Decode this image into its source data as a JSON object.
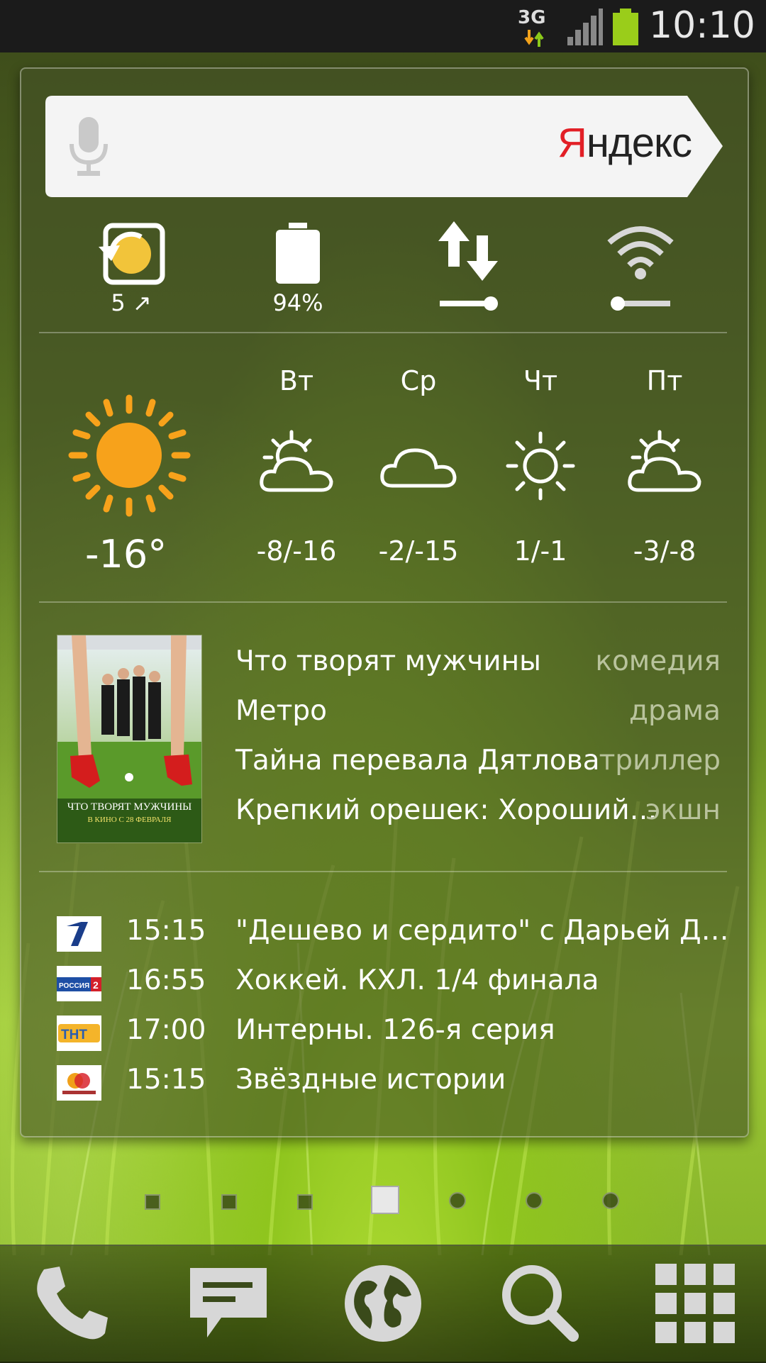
{
  "status_bar": {
    "network": "3G",
    "time": "10:10",
    "icons": [
      "data-arrows-icon",
      "signal-icon",
      "battery-icon"
    ]
  },
  "search": {
    "logo_first": "Я",
    "logo_rest": "ндекс",
    "icon": "microphone-icon"
  },
  "toggles": [
    {
      "name": "rotate",
      "icon": "screen-rotate-icon",
      "label": "5 ↗"
    },
    {
      "name": "battery",
      "icon": "battery-icon",
      "label": "94%"
    },
    {
      "name": "data",
      "icon": "data-sync-icon",
      "label": ""
    },
    {
      "name": "wifi",
      "icon": "wifi-icon",
      "label": ""
    }
  ],
  "weather": {
    "current_temp": "-16°",
    "current_icon": "sun-icon",
    "days": [
      {
        "name": "Вт",
        "icon": "partly-cloudy-icon",
        "range": "-8/-16"
      },
      {
        "name": "Ср",
        "icon": "cloud-icon",
        "range": "-2/-15"
      },
      {
        "name": "Чт",
        "icon": "sun-icon",
        "range": "1/-1"
      },
      {
        "name": "Пт",
        "icon": "partly-cloudy-icon",
        "range": "-3/-8"
      }
    ]
  },
  "movies": {
    "poster_caption": "ЧТО ТВОРЯТ МУЖЧИНЫ",
    "poster_sub": "В КИНО С 28 ФЕВРАЛЯ",
    "items": [
      {
        "title": "Что творят мужчины",
        "genre": "комедия"
      },
      {
        "title": "Метро",
        "genre": "драма"
      },
      {
        "title": "Тайна перевала Дятлова",
        "genre": "триллер"
      },
      {
        "title": "Крепкий орешек: Хороший…",
        "genre": "экшн"
      }
    ]
  },
  "tv": [
    {
      "channel": "channel-one-logo",
      "time": "15:15",
      "show": "\"Дешево и сердито\" с Дарьей Д…"
    },
    {
      "channel": "russia-2-logo",
      "time": "16:55",
      "show": "Хоккей. КХЛ. 1/4 финала"
    },
    {
      "channel": "tnt-logo",
      "time": "17:00",
      "show": "Интерны. 126-я серия"
    },
    {
      "channel": "domashny-logo",
      "time": "15:15",
      "show": "Звёздные истории"
    }
  ],
  "colors": {
    "yandex_red": "#e21f26",
    "sun_orange": "#f7a21b",
    "battery_green": "#9acd1a"
  },
  "dock": [
    "phone-icon",
    "messages-icon",
    "browser-globe-icon",
    "search-icon",
    "apps-grid-icon"
  ],
  "pages": {
    "count": 7,
    "current": 4
  }
}
